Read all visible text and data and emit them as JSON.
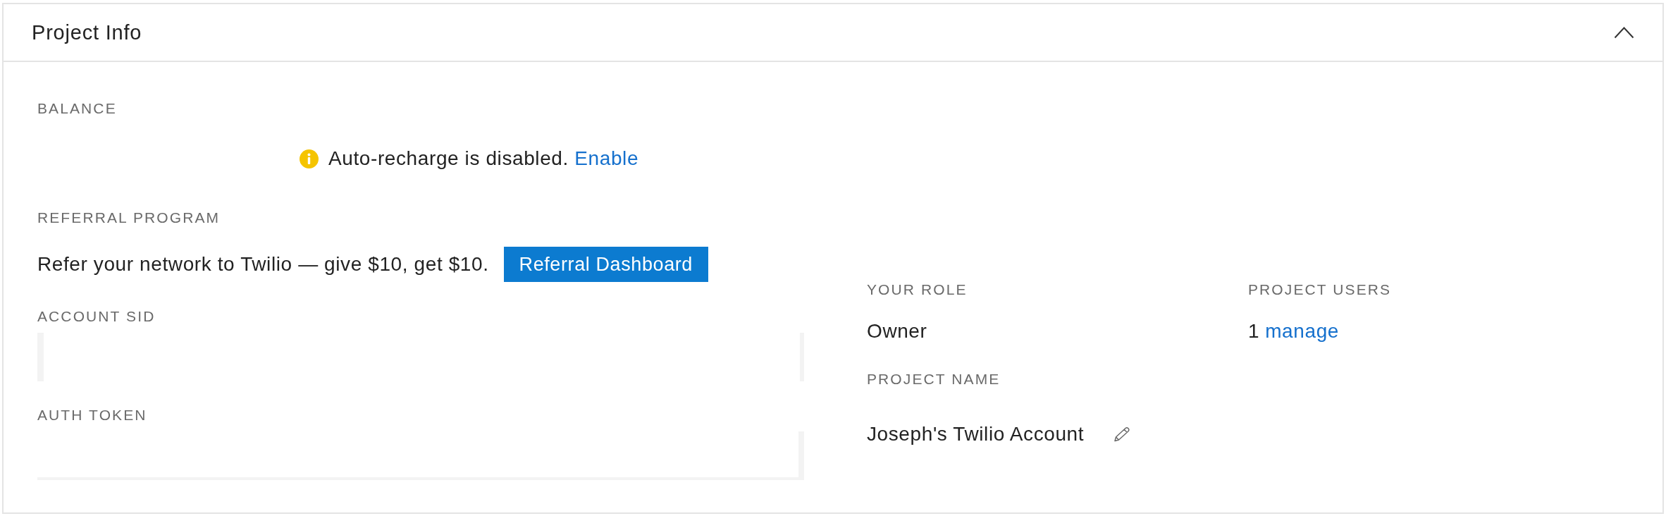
{
  "panel": {
    "title": "Project Info",
    "expanded": true
  },
  "balance": {
    "label": "BALANCE",
    "notice": {
      "text": "Auto-recharge is disabled.",
      "link": "Enable"
    }
  },
  "referral_program": {
    "label": "REFERRAL PROGRAM",
    "text": "Refer your network to Twilio — give $10, get $10.",
    "button": "Referral Dashboard"
  },
  "account_sid": {
    "label": "ACCOUNT SID"
  },
  "auth_token": {
    "label": "AUTH TOKEN"
  },
  "your_role": {
    "label": "YOUR ROLE",
    "value": "Owner"
  },
  "project_users": {
    "label": "PROJECT USERS",
    "count": "1",
    "link": "manage"
  },
  "project_name": {
    "label": "PROJECT NAME",
    "value": "Joseph's Twilio Account"
  }
}
